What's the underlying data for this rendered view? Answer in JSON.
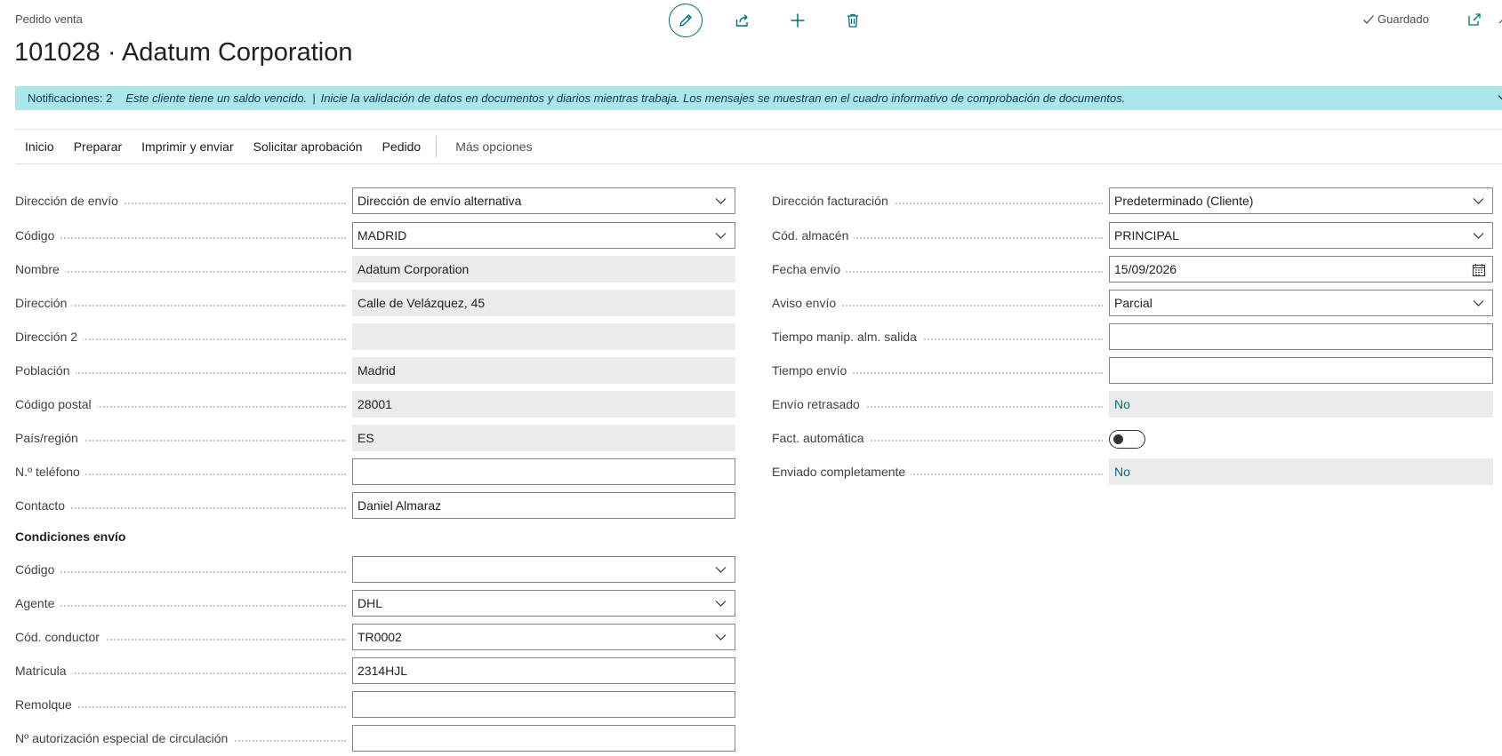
{
  "header": {
    "doc_type": "Pedido venta",
    "title": "101028 · Adatum Corporation",
    "saved_label": "Guardado",
    "actions": [
      "pencil-icon",
      "share-icon",
      "plus-icon",
      "trash-icon"
    ]
  },
  "notification": {
    "count_label": "Notificaciones: 2",
    "message1": "Este cliente tiene un saldo vencido.",
    "separator": "|",
    "message2": "Inicie la validación de datos en documentos y diarios mientras trabaja. Los mensajes se muestran en el cuadro informativo de comprobación de documentos."
  },
  "menu": {
    "items": [
      "Inicio",
      "Preparar",
      "Imprimir y enviar",
      "Solicitar aprobación",
      "Pedido"
    ],
    "more": "Más opciones"
  },
  "left": {
    "ship_to": {
      "label": "Dirección de envío",
      "value": "Dirección de envío alternativa"
    },
    "code": {
      "label": "Código",
      "value": "MADRID"
    },
    "name": {
      "label": "Nombre",
      "value": "Adatum Corporation"
    },
    "address": {
      "label": "Dirección",
      "value": "Calle de Velázquez, 45"
    },
    "address2": {
      "label": "Dirección 2",
      "value": ""
    },
    "city": {
      "label": "Población",
      "value": "Madrid"
    },
    "postcode": {
      "label": "Código postal",
      "value": "28001"
    },
    "country": {
      "label": "País/región",
      "value": "ES"
    },
    "phone": {
      "label": "N.º teléfono",
      "value": ""
    },
    "contact": {
      "label": "Contacto",
      "value": "Daniel Almaraz"
    }
  },
  "shipping_conditions": {
    "title": "Condiciones envío",
    "code": {
      "label": "Código",
      "value": ""
    },
    "agent": {
      "label": "Agente",
      "value": "DHL"
    },
    "driver": {
      "label": "Cód. conductor",
      "value": "TR0002"
    },
    "plate": {
      "label": "Matrícula",
      "value": "2314HJL"
    },
    "trailer": {
      "label": "Remolque",
      "value": ""
    },
    "permit": {
      "label": "Nº autorización especial de circulación",
      "value": ""
    }
  },
  "right": {
    "billing": {
      "label": "Dirección facturación",
      "value": "Predeterminado (Cliente)"
    },
    "warehouse": {
      "label": "Cód. almacén",
      "value": "PRINCIPAL"
    },
    "ship_date": {
      "label": "Fecha envío",
      "value": "15/09/2026"
    },
    "ship_advice": {
      "label": "Aviso envío",
      "value": "Parcial"
    },
    "handling_time": {
      "label": "Tiempo manip. alm. salida",
      "value": ""
    },
    "ship_time": {
      "label": "Tiempo envío",
      "value": ""
    },
    "late": {
      "label": "Envío retrasado",
      "value": "No"
    },
    "auto_invoice": {
      "label": "Fact. automática",
      "value": false
    },
    "fully_shipped": {
      "label": "Enviado completamente",
      "value": "No"
    }
  },
  "colors": {
    "accent": "#00707a",
    "notification_bg": "#a9e7ea",
    "readonly_bg": "#ebebeb"
  }
}
